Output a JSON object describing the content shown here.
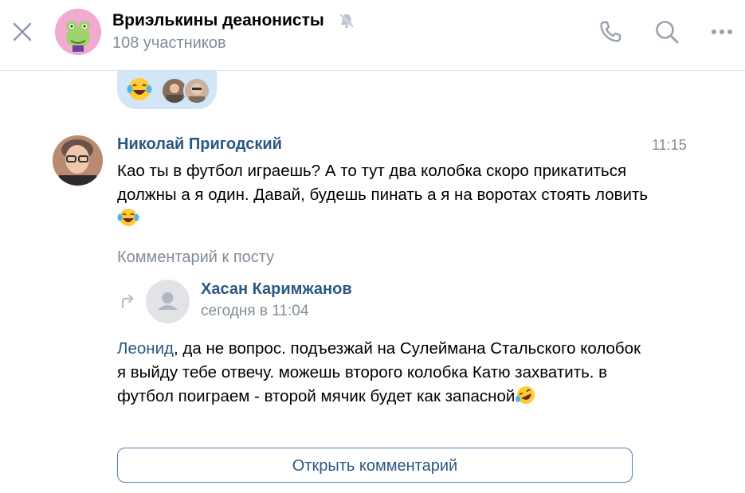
{
  "header": {
    "chat_title": "Вриэлькины деанонисты",
    "members": "108 участников",
    "icons": [
      "close-icon",
      "mute-icon",
      "phone-icon",
      "search-icon",
      "more-icon"
    ]
  },
  "reactions": {
    "emoji": "laughing-with-tears-emoji",
    "reactor_avatars": 2
  },
  "message": {
    "author": "Николай Пригодский",
    "time": "11:15",
    "text": "Као ты в футбол играешь? А то тут два колобка скоро прикатиться должны а я один. Давай, будешь пинать а я на воротах стоять ловить",
    "trailing_emoji": "joy-emoji"
  },
  "attachment": {
    "label": "Комментарий к посту",
    "original_author": "Хасан Каримжанов",
    "original_date": "сегодня в 11:04",
    "mention": "Леонид",
    "text": ", да не вопрос. подъезжай на Сулеймана Стальского колобок я выйду тебе отвечу. можешь второго колобка Катю захватить. в футбол поиграем - второй мячик будет как запасной",
    "trailing_emoji": "rofl-emoji",
    "open_button": "Открыть комментарий"
  },
  "colors": {
    "link": "#2a5885",
    "secondary_text": "#818c99",
    "reaction_bg": "#d2e6f8",
    "button_border": "#5181b8"
  }
}
